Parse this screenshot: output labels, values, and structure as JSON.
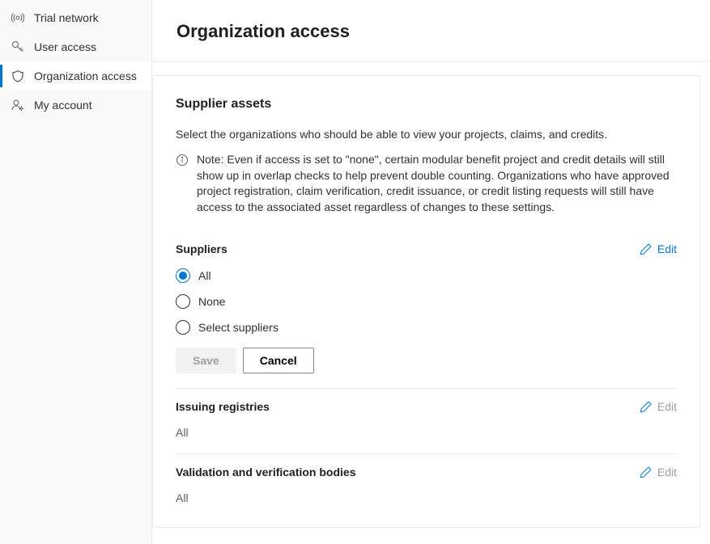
{
  "sidebar": {
    "items": [
      {
        "label": "Trial network",
        "icon": "broadcast",
        "active": false
      },
      {
        "label": "User access",
        "icon": "key",
        "active": false
      },
      {
        "label": "Organization access",
        "icon": "shield",
        "active": true
      },
      {
        "label": "My account",
        "icon": "person",
        "active": false
      }
    ]
  },
  "page": {
    "title": "Organization access"
  },
  "card": {
    "title": "Supplier assets",
    "description": "Select the organizations who should be able to view your projects, claims, and credits.",
    "note": "Note: Even if access is set to \"none\", certain modular benefit project and credit details will still show up in overlap checks to help prevent double counting. Organizations who have approved project registration, claim verification, credit issuance, or credit listing requests will still have access to the associated asset regardless of changes to these settings."
  },
  "suppliers": {
    "title": "Suppliers",
    "edit_label": "Edit",
    "options": [
      {
        "label": "All",
        "selected": true
      },
      {
        "label": "None",
        "selected": false
      },
      {
        "label": "Select suppliers",
        "selected": false
      }
    ],
    "save_label": "Save",
    "cancel_label": "Cancel"
  },
  "issuing_registries": {
    "title": "Issuing registries",
    "edit_label": "Edit",
    "value": "All"
  },
  "vvb": {
    "title": "Validation and verification bodies",
    "edit_label": "Edit",
    "value": "All"
  }
}
